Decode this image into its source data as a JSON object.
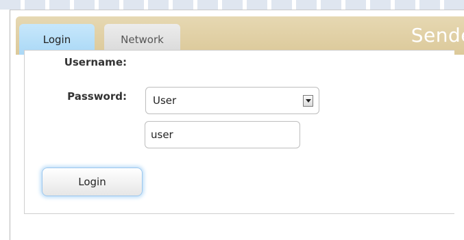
{
  "tabs": {
    "login_label": "Login",
    "network_label": "Network"
  },
  "brand": {
    "text": "Sende"
  },
  "form": {
    "username_label": "Username:",
    "username_selected": "User",
    "password_label": "Password:",
    "password_value": "user",
    "login_button": "Login"
  },
  "colors": {
    "tabbar": "#dcc99a",
    "active_tab": "#aad8f6",
    "button_glow": "#b9dcf8"
  }
}
